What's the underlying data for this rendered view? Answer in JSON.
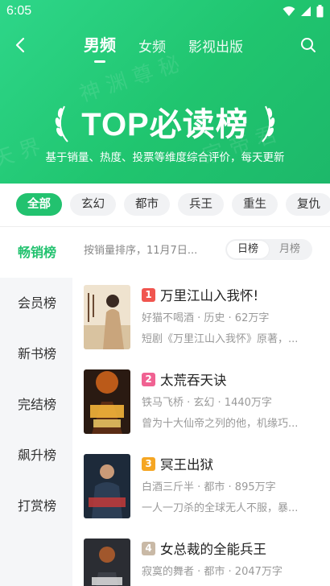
{
  "status": {
    "time": "6:05"
  },
  "nav": {
    "tabs": [
      {
        "label": "男频",
        "active": true
      },
      {
        "label": "女频",
        "active": false
      },
      {
        "label": "影视出版",
        "active": false
      }
    ]
  },
  "hero": {
    "title": "TOP必读榜",
    "subtitle": "基于销量、热度、投票等维度综合评价，每天更新"
  },
  "chips": [
    "全部",
    "玄幻",
    "都市",
    "兵王",
    "重生",
    "复仇"
  ],
  "sidebar": [
    "畅销榜",
    "会员榜",
    "新书榜",
    "完结榜",
    "飙升榜",
    "打赏榜"
  ],
  "sort": {
    "text": "按销量排序，11月7日...",
    "options": [
      "日榜",
      "月榜"
    ]
  },
  "books": [
    {
      "rank": "1",
      "title": "万里江山入我怀!",
      "meta": "好猫不喝酒 · 历史 · 62万字",
      "desc": "短剧《万里江山入我怀》原著，...",
      "rank_color": "#f0554f"
    },
    {
      "rank": "2",
      "title": "太荒吞天诀",
      "meta": "铁马飞桥 · 玄幻 · 1440万字",
      "desc": "曾为十大仙帝之列的他，机缘巧...",
      "rank_color": "#f06292"
    },
    {
      "rank": "3",
      "title": "冥王出狱",
      "meta": "白酒三斤半 · 都市 · 895万字",
      "desc": "一人一刀杀的全球无人不服，暴...",
      "rank_color": "#f5a623"
    },
    {
      "rank": "4",
      "title": "女总裁的全能兵王",
      "meta": "寂寞的舞者 · 都市 · 2047万字",
      "desc": "",
      "rank_color": "#c9b9a6"
    }
  ],
  "colors": {
    "accent": "#22c26f",
    "hero_start": "#2ed689",
    "hero_end": "#1db86a"
  }
}
